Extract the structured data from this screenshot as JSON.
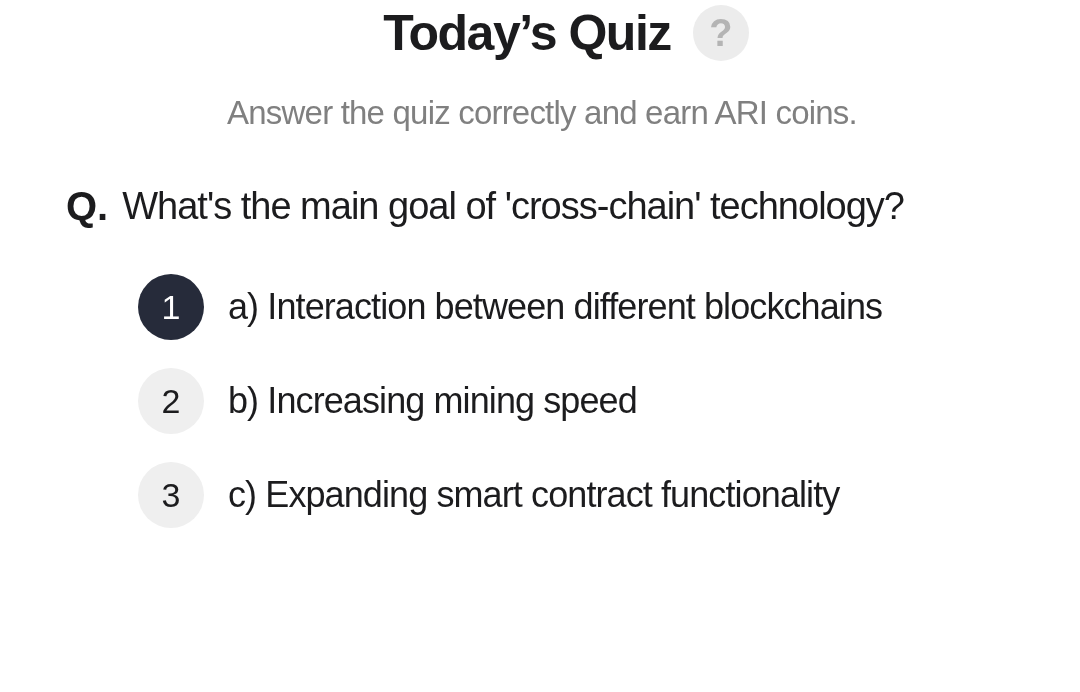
{
  "header": {
    "title": "Today’s Quiz",
    "help_icon": "?",
    "subtitle": "Answer the quiz correctly and earn ARI coins."
  },
  "question": {
    "prefix": "Q.",
    "text": "What's the main goal of 'cross-chain' technology?"
  },
  "options": [
    {
      "number": "1",
      "text": "a) Interaction between different blockchains",
      "selected": true
    },
    {
      "number": "2",
      "text": "b) Increasing mining speed",
      "selected": false
    },
    {
      "number": "3",
      "text": "c) Expanding smart contract functionality",
      "selected": false
    }
  ]
}
